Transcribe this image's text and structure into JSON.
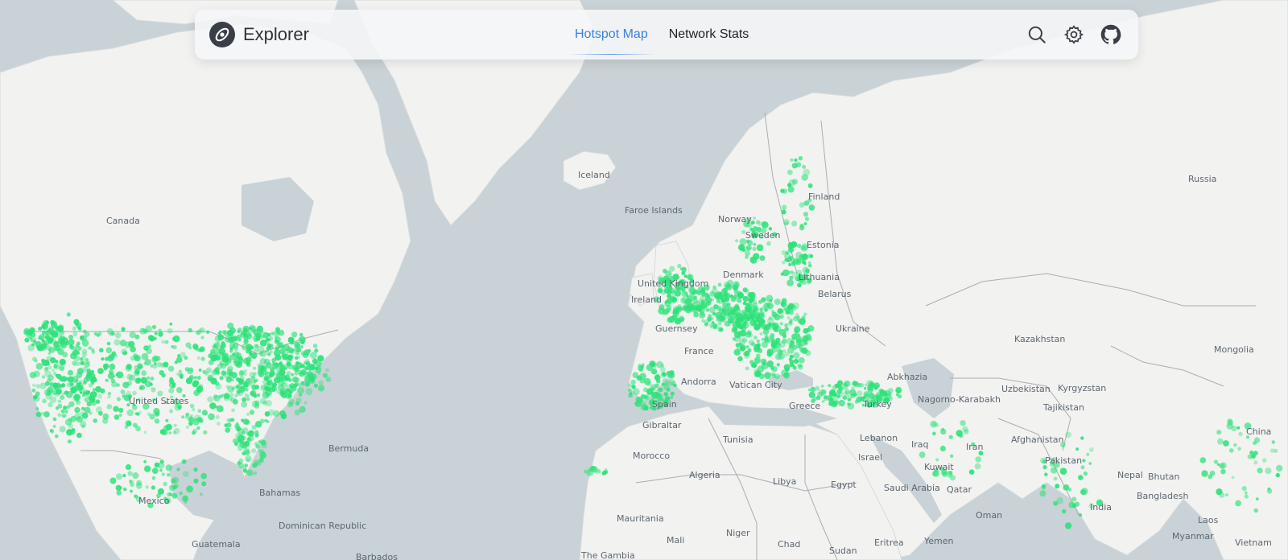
{
  "app": {
    "name": "Explorer"
  },
  "nav": {
    "tabs": [
      {
        "label": "Hotspot Map",
        "active": true
      },
      {
        "label": "Network Stats",
        "active": false
      }
    ],
    "actions": [
      "search-icon",
      "gear-icon",
      "github-icon"
    ]
  },
  "colors": {
    "accent": "#3b82e6",
    "hotspot": "#2ee27a",
    "water": "#c9d2d6",
    "land": "#f2f2f1"
  },
  "map": {
    "labels": [
      "Canada",
      "United States",
      "Mexico",
      "Guatemala",
      "Bahamas",
      "Dominican Republic",
      "Barbados",
      "Bermuda",
      "Iceland",
      "Faroe Islands",
      "Norway",
      "Sweden",
      "Finland",
      "Estonia",
      "Denmark",
      "Lithuania",
      "United Kingdom",
      "Ireland",
      "Belarus",
      "Guernsey",
      "France",
      "Ukraine",
      "Andorra",
      "Vatican City",
      "Spain",
      "Gibraltar",
      "Greece",
      "Turkey",
      "Abkhazia",
      "Nagorno-Karabakh",
      "Lebanon",
      "Israel",
      "Iraq",
      "Iran",
      "Kuwait",
      "Qatar",
      "Oman",
      "Saudi Arabia",
      "Yemen",
      "Eritrea",
      "Sudan",
      "Chad",
      "Niger",
      "Mali",
      "Mauritania",
      "The Gambia",
      "Libya",
      "Egypt",
      "Algeria",
      "Tunisia",
      "Morocco",
      "Russia",
      "Kazakhstan",
      "Uzbekistan",
      "Kyrgyzstan",
      "Tajikistan",
      "Afghanistan",
      "Pakistan",
      "India",
      "Nepal",
      "Bhutan",
      "Bangladesh",
      "Myanmar",
      "Laos",
      "Vietnam",
      "Mongolia",
      "China"
    ]
  }
}
